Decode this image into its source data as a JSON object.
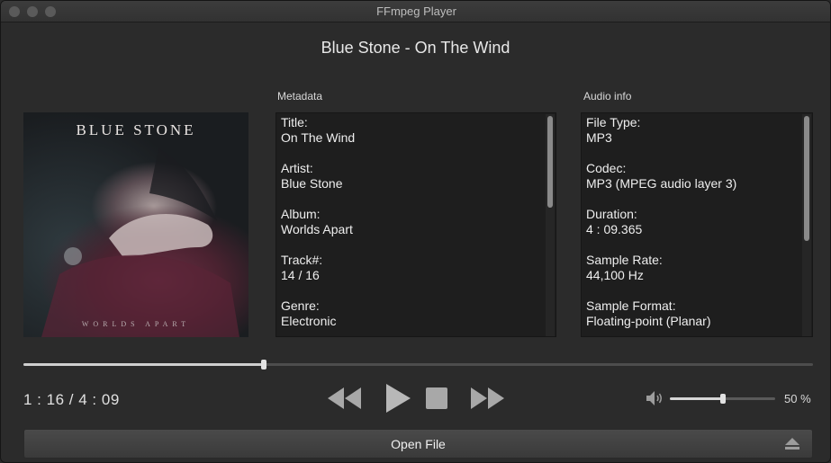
{
  "window": {
    "title": "FFmpeg Player"
  },
  "now_playing": {
    "title": "Blue Stone - On The Wind"
  },
  "cover": {
    "artist_text": "BLUE STONE",
    "album_text": "WORLDS APART"
  },
  "metadata": {
    "label": "Metadata",
    "fields": [
      {
        "label": "Title:",
        "value": "On The Wind"
      },
      {
        "label": "Artist:",
        "value": "Blue Stone"
      },
      {
        "label": "Album:",
        "value": "Worlds Apart"
      },
      {
        "label": "Track#:",
        "value": "14 / 16"
      },
      {
        "label": "Genre:",
        "value": "Electronic"
      }
    ],
    "scroll_fraction_visible": 0.42
  },
  "audio_info": {
    "label": "Audio info",
    "fields": [
      {
        "label": "File Type:",
        "value": "MP3"
      },
      {
        "label": "Codec:",
        "value": "MP3 (MPEG audio layer 3)"
      },
      {
        "label": "Duration:",
        "value": "4 : 09.365"
      },
      {
        "label": "Sample Rate:",
        "value": "44,100 Hz"
      },
      {
        "label": "Sample Format:",
        "value": "Floating-point (Planar)"
      }
    ],
    "scroll_fraction_visible": 0.57
  },
  "playback": {
    "elapsed": "1 : 16",
    "separator": "/",
    "total": "4 : 09",
    "progress": 0.305
  },
  "controls": {
    "rewind_icon": "rewind-icon",
    "play_icon": "play-icon",
    "stop_icon": "stop-icon",
    "fast_forward_icon": "fast-forward-icon"
  },
  "volume": {
    "icon": "speaker-icon",
    "level": 0.5,
    "percent_text": "50 %"
  },
  "open_file": {
    "label": "Open File",
    "icon": "eject-icon"
  },
  "colors": {
    "window_bg": "#2b2b2b",
    "panel_bg": "#1e1e1e",
    "accent": "#cfcfcf"
  }
}
